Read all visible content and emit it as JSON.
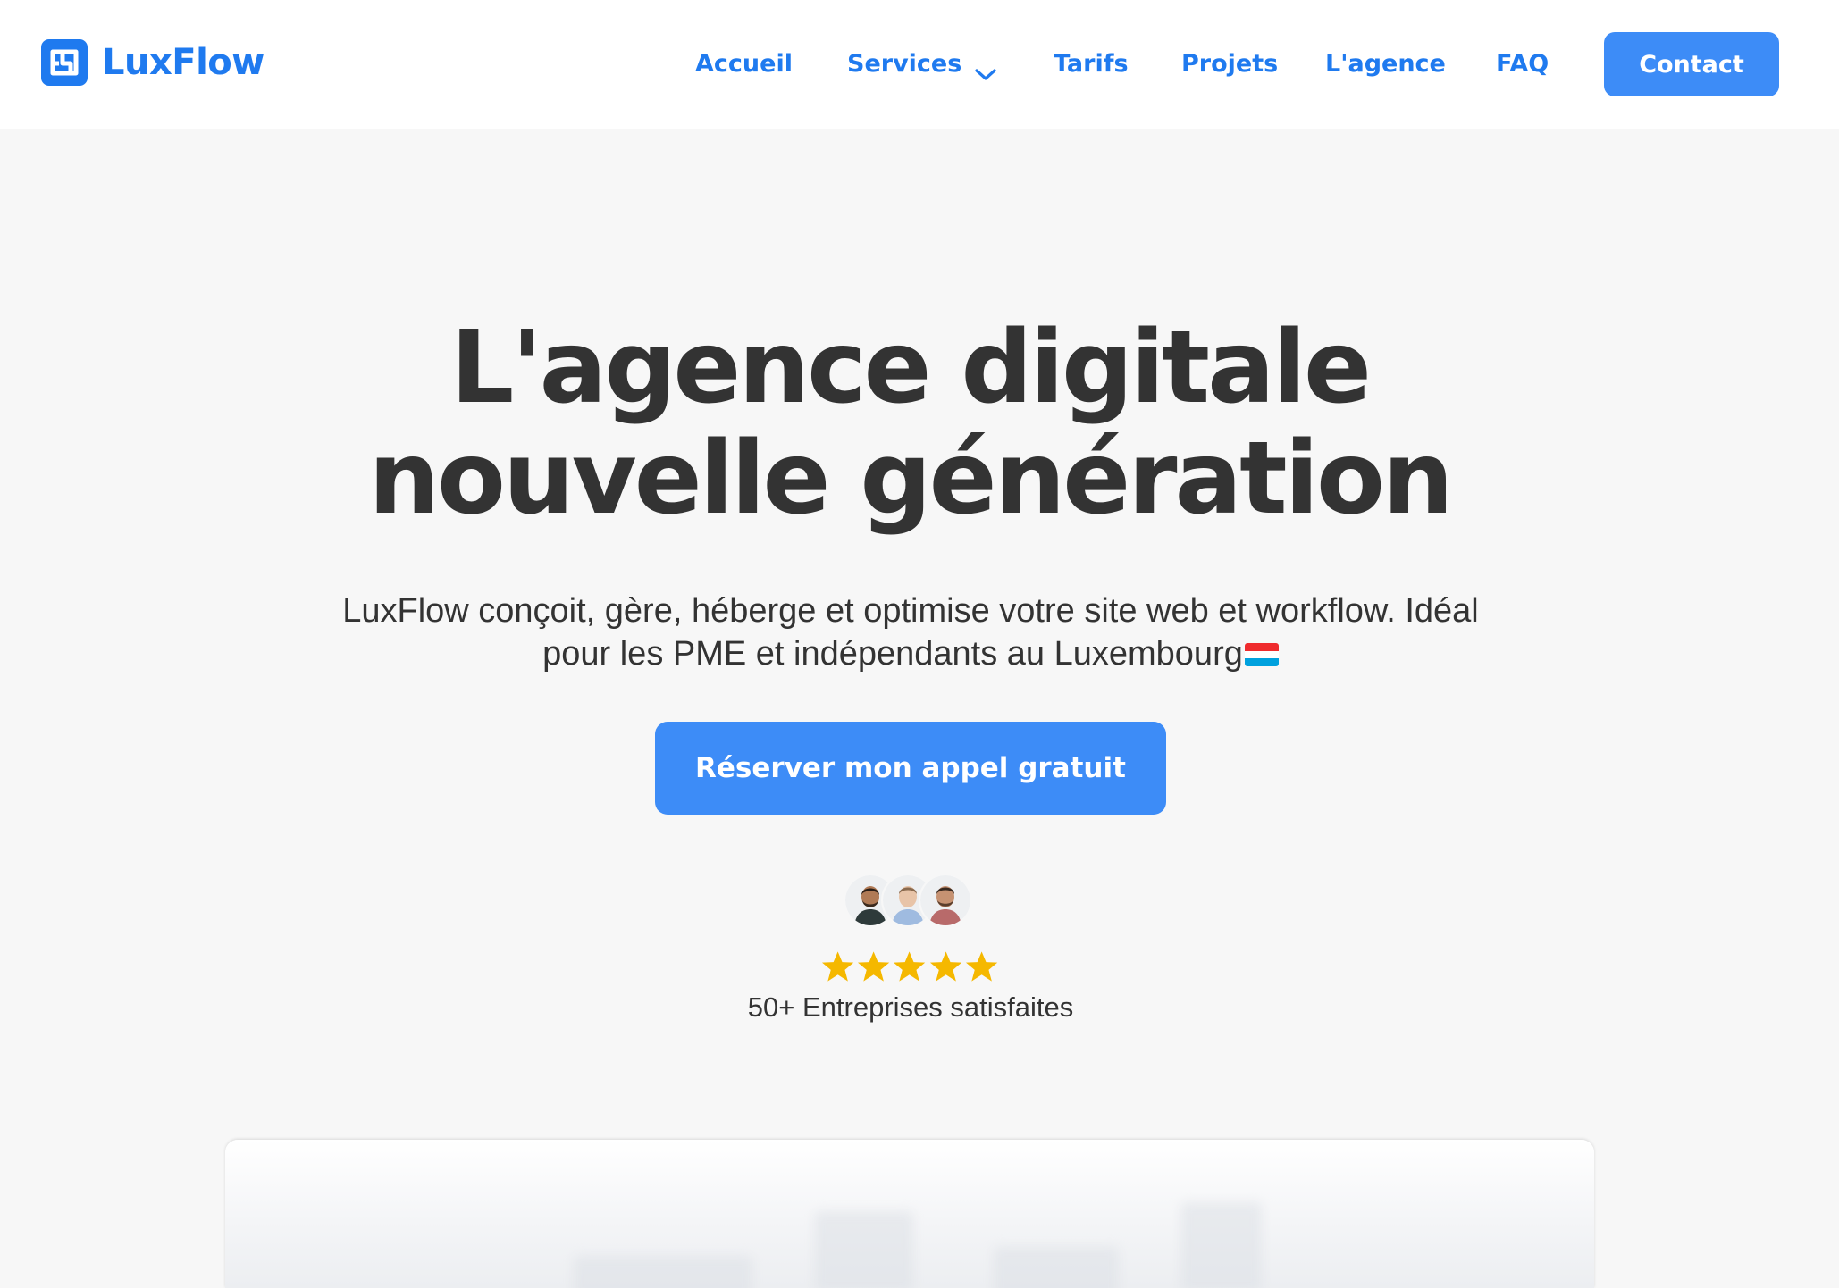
{
  "brand": {
    "name": "LuxFlow",
    "color": "#1f7aef"
  },
  "nav": {
    "items": [
      {
        "label": "Accueil"
      },
      {
        "label": "Services",
        "has_dropdown": true,
        "icon": "chevron-down-icon"
      },
      {
        "label": "Tarifs"
      },
      {
        "label": "Projets"
      },
      {
        "label": "L'agence"
      },
      {
        "label": "FAQ"
      }
    ],
    "contact_label": "Contact"
  },
  "hero": {
    "title_line1": "L'agence digitale",
    "title_line2": "nouvelle génération",
    "subtitle_line1": "LuxFlow conçoit, gère, héberge et optimise votre site web et workflow. Idéal",
    "subtitle_line2": "pour les PME et indépendants au Luxembourg",
    "flag_icon": "luxembourg-flag-icon",
    "cta_label": "Réserver mon appel gratuit"
  },
  "social_proof": {
    "avatar_count": 3,
    "rating": 5,
    "rating_max": 5,
    "text": "50+ Entreprises satisfaites"
  },
  "colors": {
    "accent": "#3d8cf7",
    "brand_text": "#1f7aef",
    "heading": "#333333",
    "background": "#f7f7f7",
    "star": "#f5b800",
    "flag": [
      "#ef2b2d",
      "#ffffff",
      "#00a1de"
    ]
  }
}
